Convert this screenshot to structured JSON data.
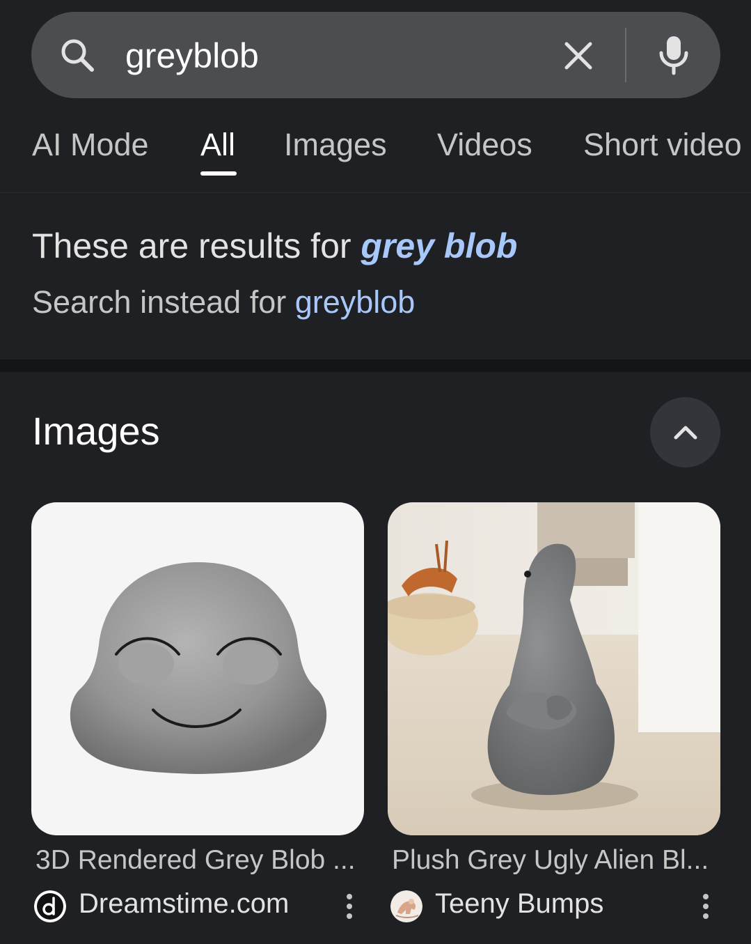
{
  "search": {
    "query": "greyblob"
  },
  "tabs": [
    {
      "label": "AI Mode"
    },
    {
      "label": "All"
    },
    {
      "label": "Images"
    },
    {
      "label": "Videos"
    },
    {
      "label": "Short video"
    }
  ],
  "correction": {
    "prefix": "These are results for ",
    "corrected_query": "grey blob",
    "instead_prefix": "Search instead for ",
    "original_query": "greyblob"
  },
  "images_section": {
    "heading": "Images",
    "results": [
      {
        "title": "3D Rendered Grey Blob ...",
        "source": "Dreamstime.com"
      },
      {
        "title": "Plush Grey Ugly Alien Bl...",
        "source": "Teeny Bumps"
      }
    ]
  },
  "colors": {
    "background": "#1f2023",
    "search_bar": "#4b4d51",
    "link_blue": "#a8c7fa"
  }
}
